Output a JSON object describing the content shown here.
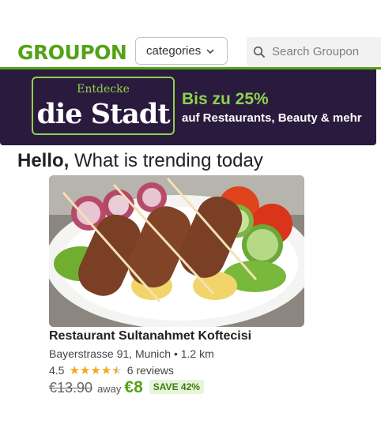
{
  "header": {
    "logo": "GROUPON",
    "categories_label": "categories",
    "search_placeholder": "Search Groupon"
  },
  "banner": {
    "small": "Entdecke",
    "big": "die Stadt",
    "headline": "Bis zu 25%",
    "sub": "auf Restaurants, Beauty & mehr"
  },
  "greeting": {
    "bold": "Hello,",
    "rest": " What is trending today"
  },
  "deal": {
    "title": "Restaurant Sultanahmet Koftecisi",
    "address": "Bayerstrasse 91, Munich • 1.2 km",
    "rating": "4.5",
    "rating_value": 4.5,
    "reviews": "6 reviews",
    "old_price": "€13.90",
    "away": "away",
    "new_price": "€8",
    "save": "SAVE 42%"
  },
  "colors": {
    "brand_green": "#53a318",
    "banner_bg": "#2a1a3d",
    "banner_accent": "#8fd14f",
    "star": "#f2a91e"
  }
}
